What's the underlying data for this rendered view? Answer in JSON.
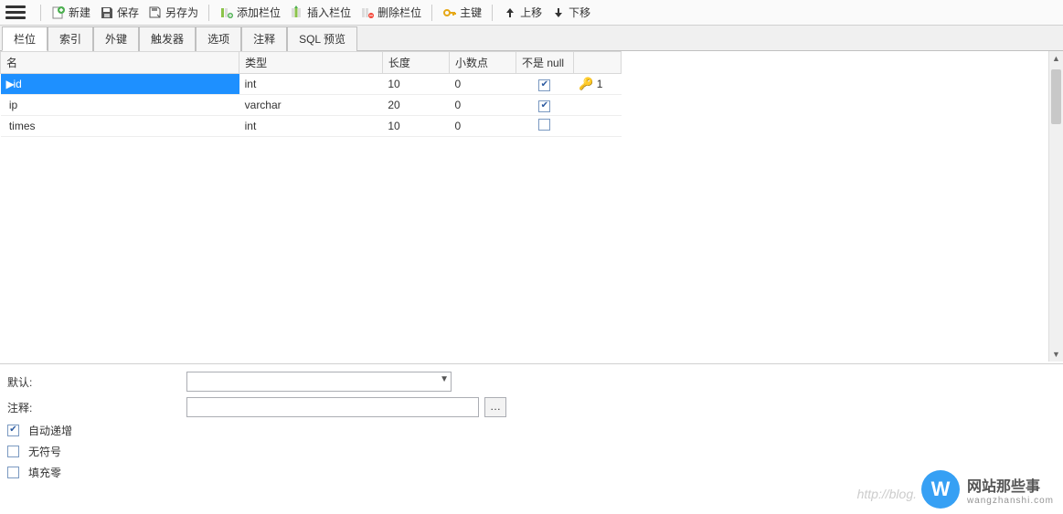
{
  "toolbar": {
    "new": "新建",
    "save": "保存",
    "saveAs": "另存为",
    "addCol": "添加栏位",
    "insertCol": "插入栏位",
    "deleteCol": "删除栏位",
    "primaryKey": "主键",
    "moveUp": "上移",
    "moveDown": "下移"
  },
  "tabs": [
    "栏位",
    "索引",
    "外键",
    "触发器",
    "选项",
    "注释",
    "SQL 预览"
  ],
  "columns": {
    "name": "名",
    "type": "类型",
    "length": "长度",
    "decimals": "小数点",
    "notNull": "不是 null",
    "key": ""
  },
  "rows": [
    {
      "name": "id",
      "type": "int",
      "length": "10",
      "decimals": "0",
      "notNull": true,
      "keyIndex": "1",
      "selected": true
    },
    {
      "name": "ip",
      "type": "varchar",
      "length": "20",
      "decimals": "0",
      "notNull": true,
      "keyIndex": "",
      "selected": false
    },
    {
      "name": "times",
      "type": "int",
      "length": "10",
      "decimals": "0",
      "notNull": false,
      "keyIndex": "",
      "selected": false
    }
  ],
  "form": {
    "defaultLabel": "默认:",
    "defaultValue": "",
    "commentLabel": "注释:",
    "commentValue": "",
    "autoInc": {
      "label": "自动递增",
      "checked": true
    },
    "unsigned": {
      "label": "无符号",
      "checked": false
    },
    "zerofill": {
      "label": "填充零",
      "checked": false
    }
  },
  "watermark": {
    "title": "网站那些事",
    "sub": "wangzhanshi.com",
    "badge": "W",
    "faintUrl": "http://blog."
  }
}
